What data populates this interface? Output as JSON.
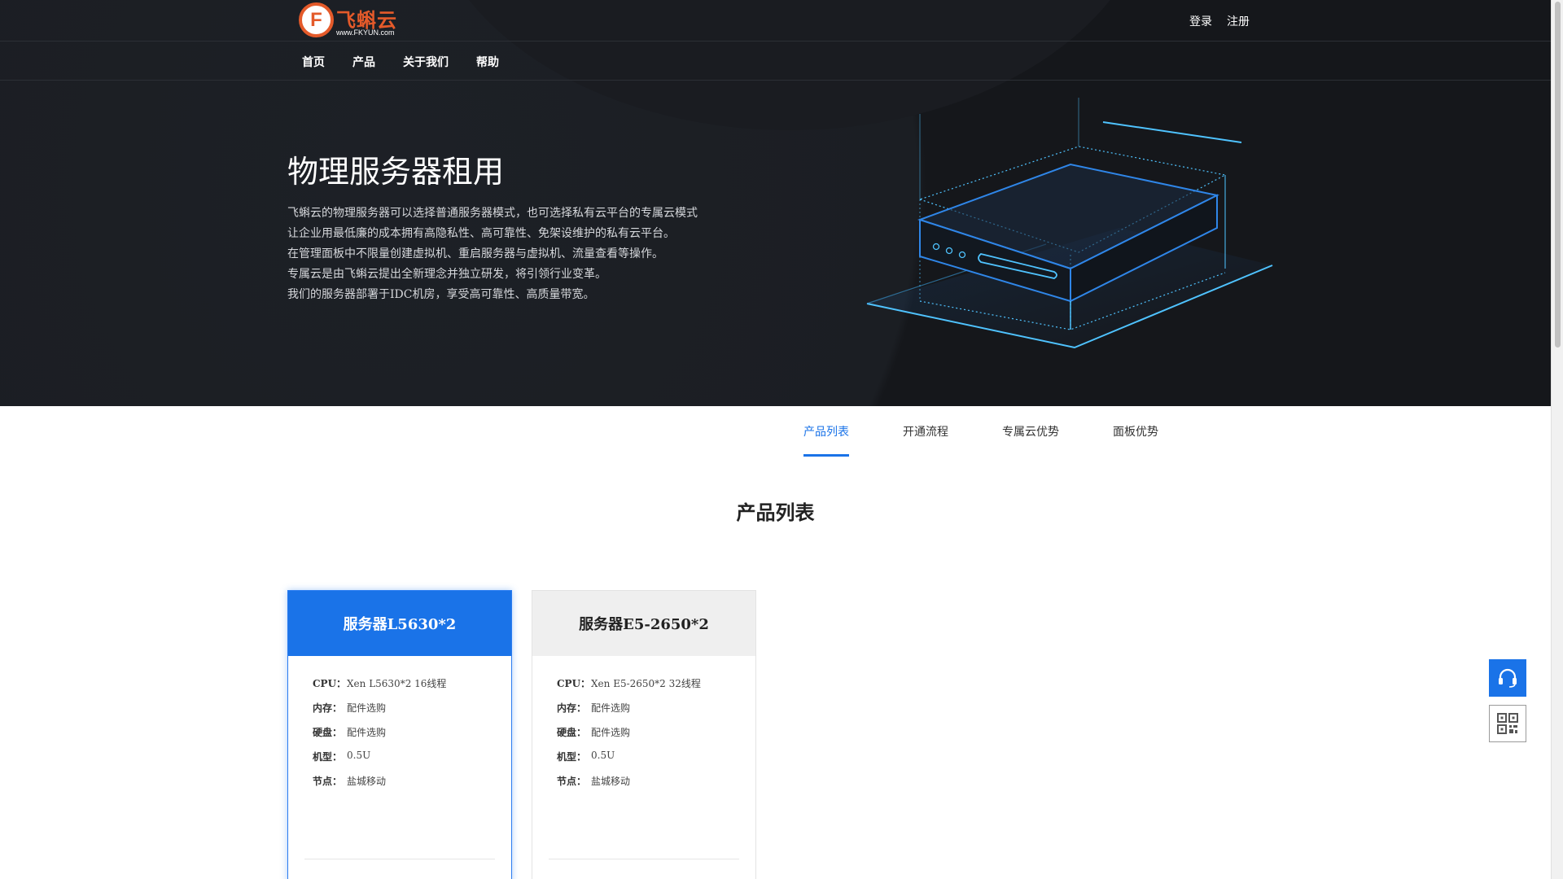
{
  "header": {
    "logo": {
      "letter": "F",
      "name": "飞蝌云",
      "url": "www.FKYUN.com"
    },
    "auth": {
      "login": "登录",
      "register": "注册"
    },
    "nav": [
      "首页",
      "产品",
      "关于我们",
      "帮助"
    ]
  },
  "hero": {
    "title": "物理服务器租用",
    "description": [
      "飞蝌云的物理服务器可以选择普通服务器模式，也可选择私有云平台的专属云模式",
      "让企业用最低廉的成本拥有高隐私性、高可靠性、免架设维护的私有云平台。",
      "在管理面板中不限量创建虚拟机、重启服务器与虚拟机、流量查看等操作。",
      "专属云是由飞蝌云提出全新理念并独立研发，将引领行业变革。",
      "我们的服务器部署于IDC机房，享受高可靠性、高质量带宽。"
    ]
  },
  "tabs": [
    "产品列表",
    "开通流程",
    "专属云优势",
    "面板优势"
  ],
  "active_tab": "产品列表",
  "section_title": "产品列表",
  "products": [
    {
      "name": "服务器L5630*2",
      "selected": true,
      "specs": [
        {
          "label": "CPU：",
          "value": "Xen L5630*2 16线程"
        },
        {
          "label": "内存：",
          "value": "配件选购"
        },
        {
          "label": "硬盘：",
          "value": "配件选购"
        },
        {
          "label": "机型：",
          "value": "0.5U"
        },
        {
          "label": "节点：",
          "value": "盐城移动"
        }
      ]
    },
    {
      "name": "服务器E5-2650*2",
      "selected": false,
      "specs": [
        {
          "label": "CPU：",
          "value": "Xen E5-2650*2 32线程"
        },
        {
          "label": "内存：",
          "value": "配件选购"
        },
        {
          "label": "硬盘：",
          "value": "配件选购"
        },
        {
          "label": "机型：",
          "value": "0.5U"
        },
        {
          "label": "节点：",
          "value": "盐城移动"
        }
      ]
    }
  ],
  "floating": {
    "support_icon": "headset-icon",
    "qr_icon": "qr-code-icon"
  },
  "colors": {
    "accent": "#1a73e8",
    "brand": "#e45a2a",
    "hero_bg": "#15171b",
    "illustration": "#4fc3ff"
  }
}
